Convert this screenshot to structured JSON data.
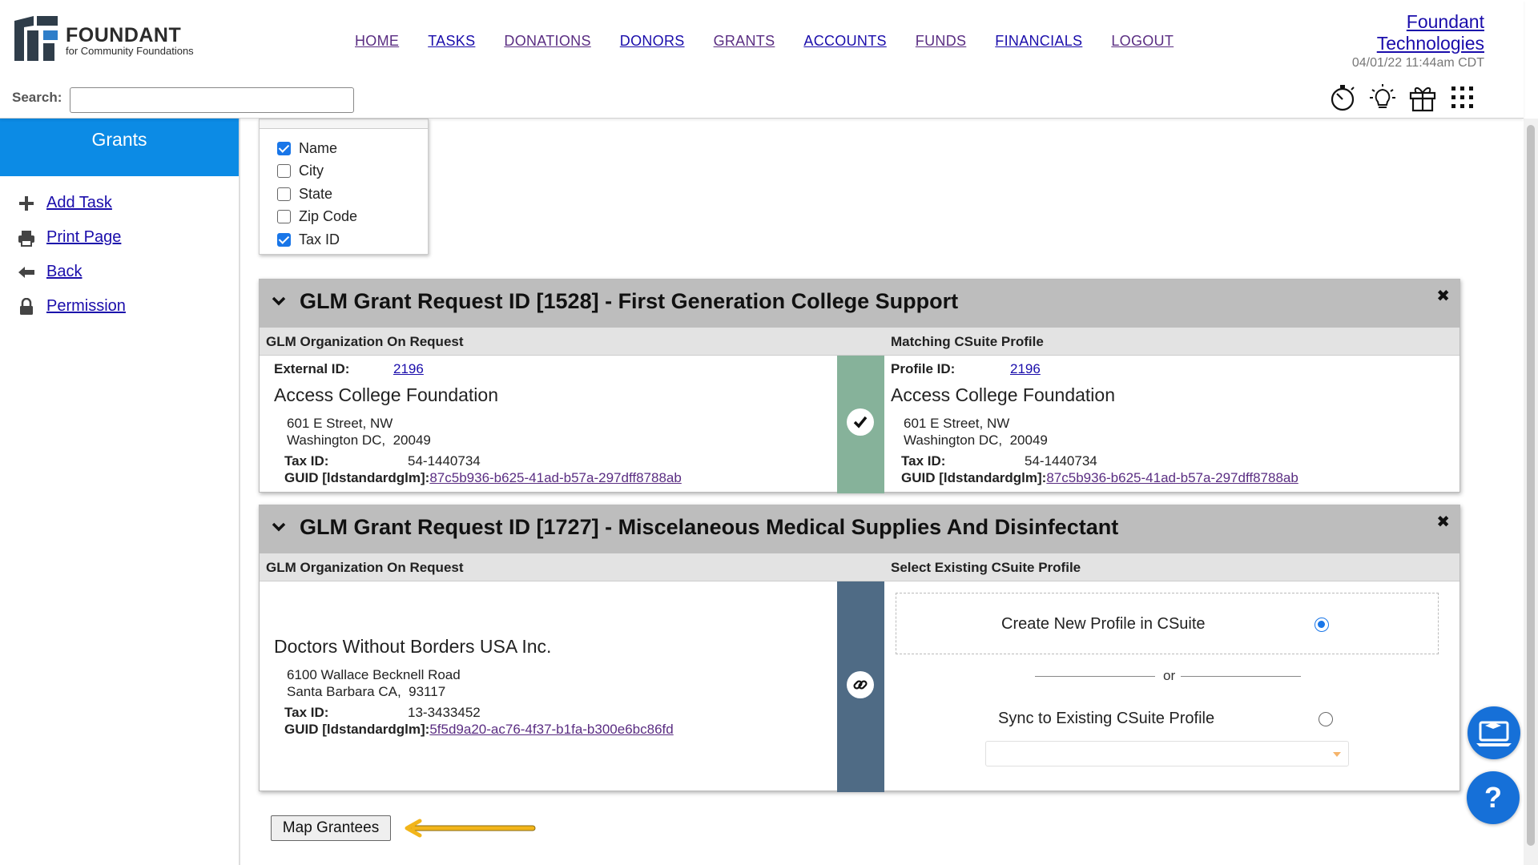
{
  "header": {
    "logo": {
      "brand": "FOUNDANT",
      "tagline": "for Community Foundations"
    },
    "nav": [
      "HOME",
      "TASKS",
      "DONATIONS",
      "DONORS",
      "GRANTS",
      "ACCOUNTS",
      "FUNDS",
      "FINANCIALS",
      "LOGOUT"
    ],
    "org_link_line1": "Foundant",
    "org_link_line2": "Technologies",
    "datetime": "04/01/22 11:44am CDT",
    "search_label": "Search:",
    "search_value": "",
    "tool_icons": [
      "stopwatch-icon",
      "lightbulb-icon",
      "gift-icon",
      "apps-grid-icon"
    ]
  },
  "sidebar": {
    "title": "Grants",
    "items": [
      {
        "label": "Add Task",
        "icon": "plus-icon"
      },
      {
        "label": "Print Page",
        "icon": "printer-icon"
      },
      {
        "label": "Back",
        "icon": "arrow-left-icon"
      },
      {
        "label": "Permission",
        "icon": "lock-icon"
      }
    ]
  },
  "filter": {
    "options": [
      {
        "label": "Name",
        "checked": true
      },
      {
        "label": "City",
        "checked": false
      },
      {
        "label": "State",
        "checked": false
      },
      {
        "label": "Zip Code",
        "checked": false
      },
      {
        "label": "Tax ID",
        "checked": true
      }
    ]
  },
  "cards": [
    {
      "title": "GLM Grant Request ID [1528] - First Generation College Support",
      "left_header": "GLM Organization On Request",
      "right_header": "Matching CSuite Profile",
      "status_color": "#86b29a",
      "left": {
        "external_id_label": "External ID:",
        "external_id": "2196",
        "name": "Access College Foundation",
        "address1": "601 E Street, NW",
        "address2": "Washington DC,  20049",
        "tax_label": "Tax ID:",
        "tax_id": "54-1440734",
        "guid_label": "GUID [ldstandardglm]:",
        "guid": "87c5b936-b625-41ad-b57a-297dff8788ab"
      },
      "right": {
        "profile_id_label": "Profile ID:",
        "profile_id": "2196",
        "name": "Access College Foundation",
        "address1": "601 E Street, NW",
        "address2": "Washington DC,  20049",
        "tax_label": "Tax ID:",
        "tax_id": "54-1440734",
        "guid_label": "GUID [ldstandardglm]:",
        "guid": "87c5b936-b625-41ad-b57a-297dff8788ab"
      }
    },
    {
      "title": "GLM Grant Request ID [1727] - Miscelaneous Medical Supplies And Disinfectant",
      "left_header": "GLM Organization On Request",
      "right_header": "Select Existing CSuite Profile",
      "status_color": "#4f6b85",
      "left": {
        "name": "Doctors Without Borders USA Inc.",
        "address1": "6100 Wallace Becknell Road",
        "address2": "Santa Barbara CA,  93117",
        "tax_label": "Tax ID:",
        "tax_id": "13-3433452",
        "guid_label": "GUID [ldstandardglm]:",
        "guid": "5f5d9a20-ac76-4f37-b1fa-b300e6bc86fd"
      },
      "right": {
        "create_label": "Create New Profile in CSuite",
        "create_selected": true,
        "or_label": "or",
        "sync_label": "Sync to Existing CSuite Profile",
        "sync_selected": false,
        "profile_select_value": ""
      }
    }
  ],
  "map_button": "Map Grantees",
  "colors": {
    "sidebar_accent": "#0c8be5",
    "matched": "#86b29a",
    "unmatched": "#4f6b85",
    "arrow": "#f2b51a"
  }
}
